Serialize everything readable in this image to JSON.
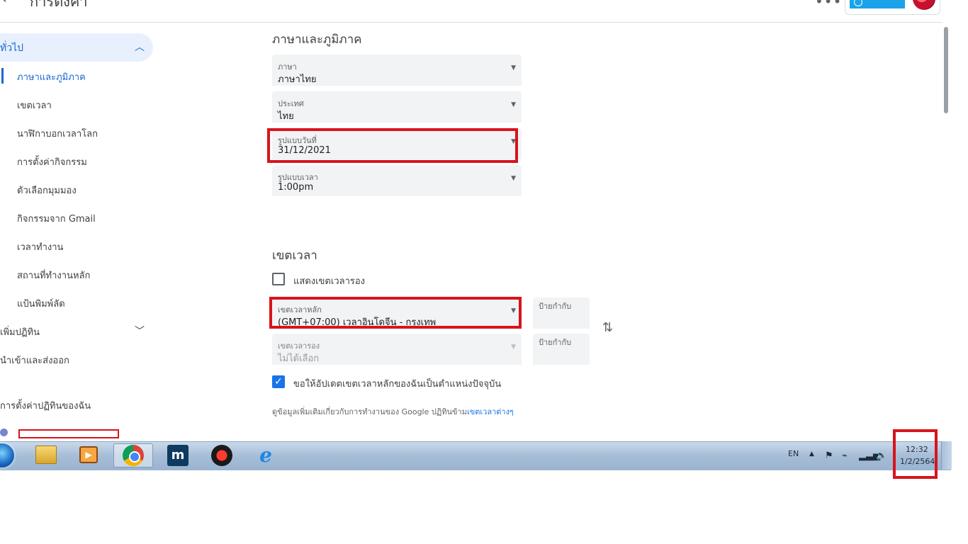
{
  "topbar": {
    "back_icon": "arrow-left-icon",
    "title": "การตั้งค่า",
    "more_icon": "more-horiz-icon",
    "workspace_badge": "",
    "avatar_icon": "avatar"
  },
  "sidebar": {
    "general": {
      "label": "ทั่วไป",
      "chevron": "chevron-up-icon"
    },
    "sub_items": [
      {
        "label": "ภาษาและภูมิภาค",
        "active": true
      },
      {
        "label": "เขตเวลา"
      },
      {
        "label": "นาฬิกาบอกเวลาโลก"
      },
      {
        "label": "การตั้งค่ากิจกรรม"
      },
      {
        "label": "ตัวเลือกมุมมอง"
      },
      {
        "label": "กิจกรรมจาก Gmail"
      },
      {
        "label": "เวลาทำงาน"
      },
      {
        "label": "สถานที่ทำงานหลัก"
      },
      {
        "label": "แป้นพิมพ์ลัด"
      }
    ],
    "add_calendar": {
      "label": "เพิ่มปฏิทิน",
      "chevron": "chevron-down-icon"
    },
    "import_export": {
      "label": "นำเข้าและส่งออก"
    },
    "my_calendars": {
      "label": "การตั้งค่าปฏิทินของฉัน"
    },
    "calendar_color": "#7986cb"
  },
  "language_region": {
    "heading": "ภาษาและภูมิภาค",
    "language": {
      "label": "ภาษา",
      "value": "ภาษาไทย"
    },
    "country": {
      "label": "ประเทศ",
      "value": "ไทย"
    },
    "date_format": {
      "label": "รูปแบบวันที่",
      "value": "31/12/2021"
    },
    "time_format": {
      "label": "รูปแบบเวลา",
      "value": "1:00pm"
    }
  },
  "time_zone": {
    "heading": "เขตเวลา",
    "show_secondary": {
      "label": "แสดงเขตเวลารอง",
      "checked": false
    },
    "primary": {
      "label": "เขตเวลาหลัก",
      "value": "(GMT+07:00) เวลาอินโดจีน - กรุงเทพ",
      "tag_label": "ป้ายกำกับ"
    },
    "secondary": {
      "label": "เขตเวลารอง",
      "value": "ไม่ได้เลือก",
      "tag_label": "ป้ายกำกับ",
      "disabled": true
    },
    "swap_icon": "swap-vert-icon",
    "update_to_location": {
      "label": "ขอให้อัปเดตเขตเวลาหลักของฉันเป็นตำแหน่งปัจจุบัน",
      "checked": true
    },
    "info_prefix": "ดูข้อมูลเพิ่มเติมเกี่ยวกับการทำงานของ Google ปฏิทินข้าม",
    "info_link": "เขตเวลาต่างๆ"
  },
  "taskbar": {
    "pinned": [
      "start-orb",
      "file-explorer-icon",
      "media-player-icon",
      "chrome-icon",
      "maxthon-icon",
      "game-icon",
      "internet-explorer-icon"
    ],
    "media_glyph": "▶",
    "maxthon_glyph": "m",
    "ie_glyph": "e",
    "tray": {
      "language": "EN",
      "up_arrow": "▲",
      "flag_icon": "⚑",
      "power_icon": "⌁",
      "network_icon": "▂▃▅",
      "volume_icon": "🔊"
    },
    "clock": {
      "time": "12:32",
      "date": "1/2/2564"
    }
  },
  "annotation_color": "#d8141c",
  "accent_color": "#1a73e8"
}
